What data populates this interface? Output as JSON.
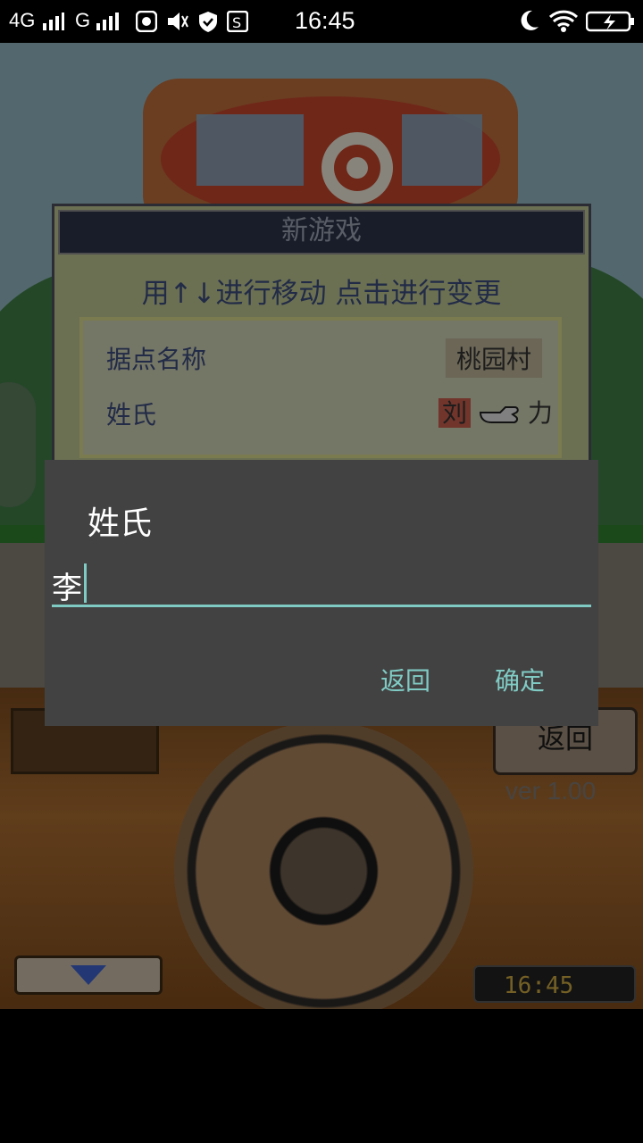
{
  "status_bar": {
    "signal_1": "4G",
    "signal_2": "G",
    "time": "16:45"
  },
  "game": {
    "new_game_window": {
      "title": "新游戏",
      "hint": "用↑↓进行移动 点击进行变更",
      "rows": [
        {
          "label": "据点名称",
          "value": "桃园村"
        },
        {
          "label": "姓氏",
          "value_surname": "刘",
          "value_given": "力"
        }
      ]
    },
    "back_button": "返回",
    "version": "ver 1.00",
    "clock": "16:45"
  },
  "dialog": {
    "title": "姓氏",
    "input_value": "李",
    "cancel_label": "返回",
    "confirm_label": "确定"
  },
  "colors": {
    "accent": "#80cbc4",
    "dialog_bg": "#424242"
  }
}
